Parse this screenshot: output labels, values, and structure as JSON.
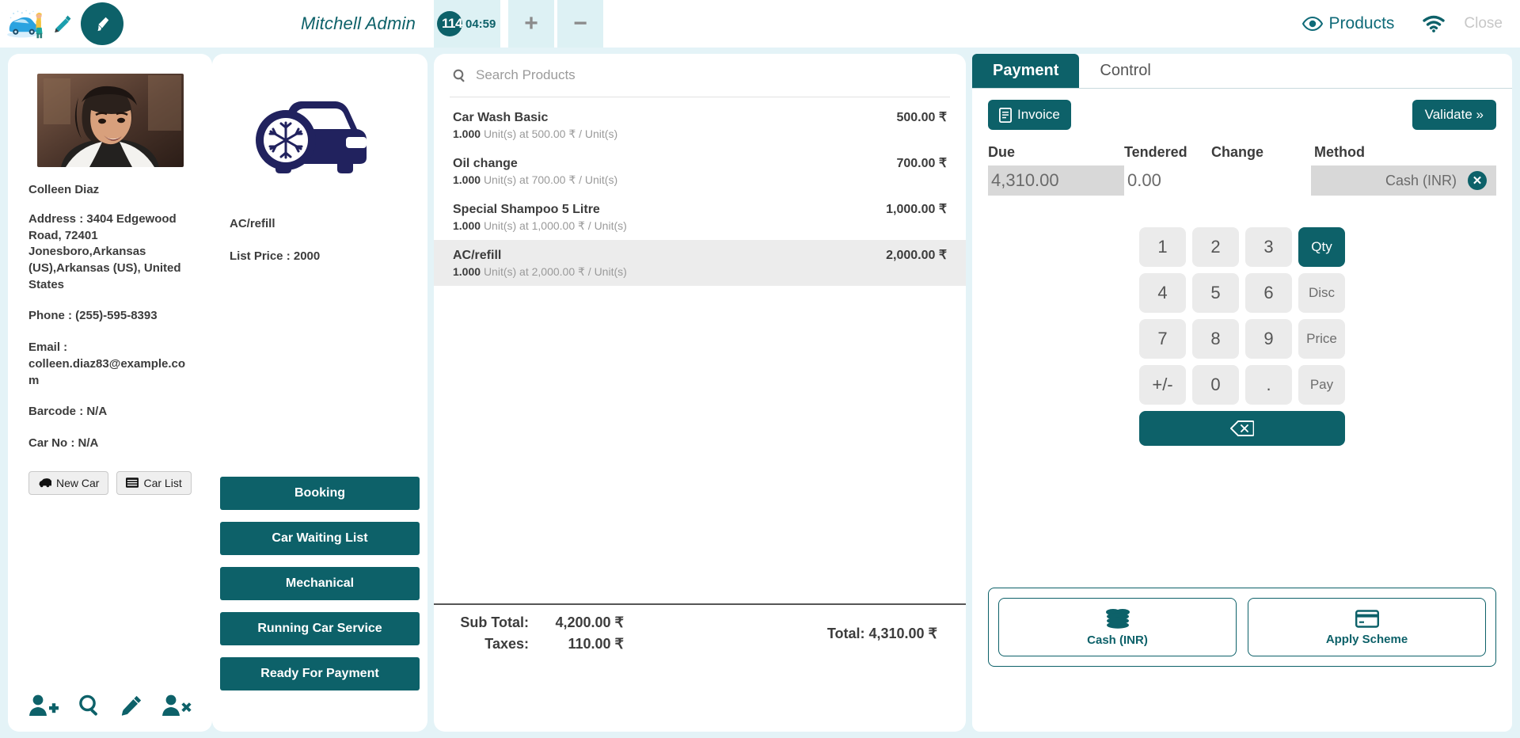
{
  "header": {
    "logo_icon": "car-wash-logo",
    "edit_icon": "pencil-icon",
    "brush_icon": "brush-icon",
    "admin_name": "Mitchell Admin",
    "order_number": "114",
    "order_time": "04:59",
    "plus_label": "+",
    "minus_label": "−",
    "products_label": "Products",
    "products_icon": "eye-icon",
    "wifi_icon": "wifi-icon",
    "close_label": "Close",
    "accent_color": "#0d6169",
    "header_cell_bg": "#ddf1f4"
  },
  "customer": {
    "avatar_alt": "customer-photo",
    "name": "Colleen Diaz",
    "address": "Address : 3404 Edgewood Road, 72401 Jonesboro,Arkansas (US),Arkansas (US), United States",
    "phone": "Phone : (255)-595-8393",
    "email": "Email : colleen.diaz83@example.com",
    "barcode": "Barcode : N/A",
    "car_no": "Car No : N/A",
    "new_car_label": "New Car",
    "car_list_label": "Car List",
    "toolbar": [
      {
        "name": "add-customer-icon"
      },
      {
        "name": "search-customer-icon"
      },
      {
        "name": "edit-customer-icon"
      },
      {
        "name": "remove-customer-icon"
      }
    ]
  },
  "product": {
    "image_icon": "car-ac-snowflake-icon",
    "name": "AC/refill",
    "list_price": "List Price : 2000",
    "actions": [
      {
        "label": "Booking"
      },
      {
        "label": "Car Waiting List"
      },
      {
        "label": "Mechanical"
      },
      {
        "label": "Running Car Service"
      },
      {
        "label": "Ready For Payment"
      }
    ]
  },
  "order": {
    "search_placeholder": "Search Products",
    "search_value": "",
    "search_icon": "search-icon",
    "lines": [
      {
        "name": "Car Wash Basic",
        "price": "500.00 ₹",
        "qty": "1.000",
        "detail": "Unit(s) at 500.00 ₹ / Unit(s)",
        "selected": false
      },
      {
        "name": "Oil change",
        "price": "700.00 ₹",
        "qty": "1.000",
        "detail": "Unit(s) at 700.00 ₹ / Unit(s)",
        "selected": false
      },
      {
        "name": "Special Shampoo 5 Litre",
        "price": "1,000.00 ₹",
        "qty": "1.000",
        "detail": "Unit(s) at 1,000.00 ₹ / Unit(s)",
        "selected": false
      },
      {
        "name": "AC/refill",
        "price": "2,000.00 ₹",
        "qty": "1.000",
        "detail": "Unit(s) at 2,000.00 ₹ / Unit(s)",
        "selected": true
      }
    ],
    "subtotal_label": "Sub Total:",
    "subtotal_value": "4,200.00 ₹",
    "taxes_label": "Taxes:",
    "taxes_value": "110.00 ₹",
    "total_label": "Total: 4,310.00 ₹"
  },
  "payment": {
    "tabs": [
      {
        "label": "Payment",
        "active": true
      },
      {
        "label": "Control",
        "active": false
      }
    ],
    "invoice_label": "Invoice",
    "invoice_icon": "document-icon",
    "validate_label": "Validate »",
    "columns": {
      "due": "Due",
      "tendered": "Tendered",
      "change": "Change",
      "method": "Method"
    },
    "values": {
      "due": "4,310.00",
      "tendered": "0.00",
      "change": "",
      "method": "Cash (INR)"
    },
    "delete_icon": "delete-payment-line-icon",
    "keypad": [
      [
        {
          "label": "1"
        },
        {
          "label": "2"
        },
        {
          "label": "3"
        },
        {
          "label": "Qty",
          "active": true,
          "small": true
        }
      ],
      [
        {
          "label": "4"
        },
        {
          "label": "5"
        },
        {
          "label": "6"
        },
        {
          "label": "Disc",
          "small": true
        }
      ],
      [
        {
          "label": "7"
        },
        {
          "label": "8"
        },
        {
          "label": "9"
        },
        {
          "label": "Price",
          "small": true
        }
      ],
      [
        {
          "label": "+/-"
        },
        {
          "label": "0"
        },
        {
          "label": "."
        },
        {
          "label": "Pay",
          "small": true
        }
      ]
    ],
    "backspace_icon": "backspace-icon",
    "methods": [
      {
        "label": "Cash (INR)",
        "icon": "coins-icon"
      },
      {
        "label": "Apply Scheme",
        "icon": "credit-card-icon"
      }
    ]
  }
}
